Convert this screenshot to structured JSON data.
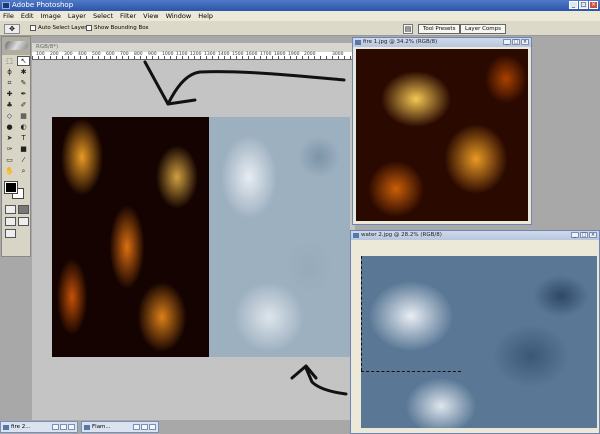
{
  "app": {
    "title": "Adobe Photoshop"
  },
  "menu": [
    "File",
    "Edit",
    "Image",
    "Layer",
    "Select",
    "Filter",
    "View",
    "Window",
    "Help"
  ],
  "options_bar": {
    "auto_select_layer": "Auto Select Layer",
    "show_bounding_box": "Show Bounding Box"
  },
  "palette_well": {
    "tool_presets": "Tool Presets",
    "layer_comps": "Layer Comps"
  },
  "main_doc": {
    "tab_label": "RGB/8*)",
    "ruler_labels": [
      "100",
      "200",
      "300",
      "400",
      "500",
      "600",
      "700",
      "800",
      "900",
      "1000",
      "1100",
      "1200",
      "1300",
      "1400",
      "1500",
      "1600",
      "1700",
      "1800",
      "1900",
      "2000",
      "3000"
    ]
  },
  "windows": {
    "fire1": {
      "title": "fire 1.jpg @ 34.2% (RGB/8)"
    },
    "water2": {
      "title": "water 2.jpg @ 28.2% (RGB/8)"
    }
  },
  "taskbar": [
    {
      "label": "fire 2..."
    },
    {
      "label": "Flam..."
    }
  ],
  "colors": {
    "titlebar": "#2d55a8",
    "foreground": "#000000",
    "background": "#ffffff"
  }
}
